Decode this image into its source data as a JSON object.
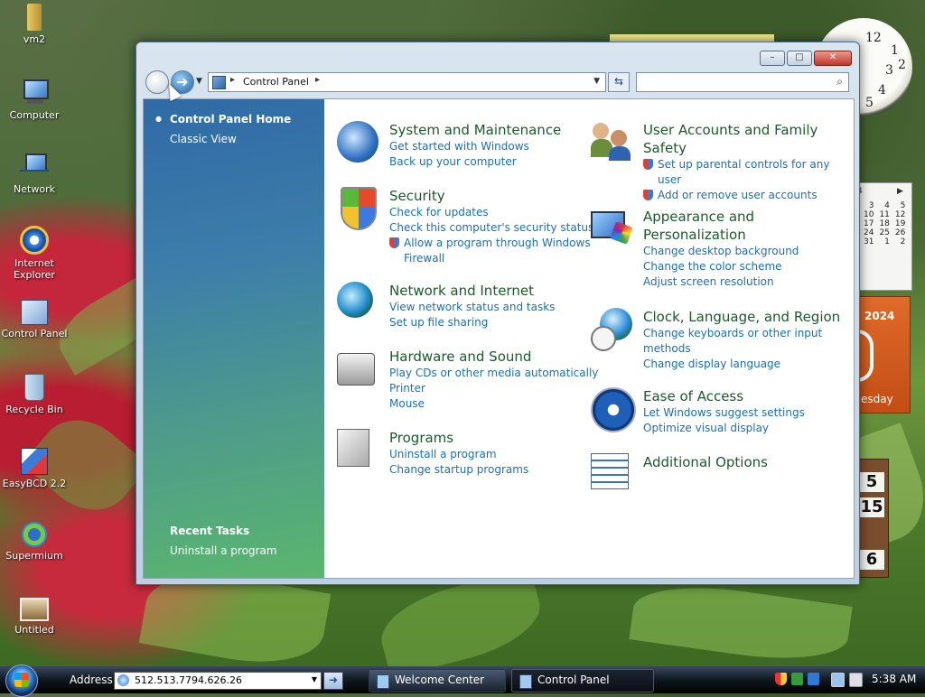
{
  "desktop": {
    "icons": [
      {
        "label": "vm2"
      },
      {
        "label": "Computer"
      },
      {
        "label": "Network"
      },
      {
        "label": "Internet Explorer"
      },
      {
        "label": "Control Panel"
      },
      {
        "label": "Recycle Bin"
      },
      {
        "label": "EasyBCD 2.2"
      },
      {
        "label": "Supermium"
      },
      {
        "label": "Untitled"
      }
    ]
  },
  "gadgets": {
    "clock_numbers": [
      "12",
      "1",
      "2",
      "3",
      "4",
      "5"
    ],
    "calendar_rows": [
      [
        "3",
        "4",
        "5"
      ],
      [
        "10",
        "11",
        "12"
      ],
      [
        "17",
        "18",
        "19"
      ],
      [
        "24",
        "25",
        "26"
      ],
      [
        "31",
        "1",
        "2"
      ]
    ],
    "calendar_header": "4",
    "calendar_year": "2024",
    "calendar_day_fragment": "esday",
    "counter_values": [
      "5",
      "15",
      "6"
    ]
  },
  "window": {
    "title_buttons": {
      "minimize": "–",
      "maximize": "□",
      "close": "✕"
    },
    "address": {
      "crumb": "Control Panel"
    },
    "search": {
      "placeholder": ""
    },
    "sidebar": {
      "home": "Control Panel Home",
      "classic": "Classic View",
      "recent_title": "Recent Tasks",
      "recent_item": "Uninstall a program"
    },
    "categories_left": [
      {
        "title": "System and Maintenance",
        "links": [
          "Get started with Windows",
          "Back up your computer"
        ],
        "icon": "system-maintenance-icon"
      },
      {
        "title": "Security",
        "links": [
          "Check for updates",
          "Check this computer's security status"
        ],
        "shield_links": [
          "Allow a program through Windows Firewall"
        ],
        "icon": "security-shield-icon"
      },
      {
        "title": "Network and Internet",
        "links": [
          "View network status and tasks",
          "Set up file sharing"
        ],
        "icon": "network-internet-icon"
      },
      {
        "title": "Hardware and Sound",
        "links": [
          "Play CDs or other media automatically",
          "Printer",
          "Mouse"
        ],
        "icon": "hardware-sound-icon"
      },
      {
        "title": "Programs",
        "links": [
          "Uninstall a program",
          "Change startup programs"
        ],
        "icon": "programs-icon"
      }
    ],
    "categories_right": [
      {
        "title": "User Accounts and Family Safety",
        "shield_links": [
          "Set up parental controls for any user",
          "Add or remove user accounts"
        ],
        "icon": "user-accounts-icon"
      },
      {
        "title": "Appearance and Personalization",
        "links": [
          "Change desktop background",
          "Change the color scheme",
          "Adjust screen resolution"
        ],
        "icon": "appearance-icon"
      },
      {
        "title": "Clock, Language, and Region",
        "links": [
          "Change keyboards or other input methods",
          "Change display language"
        ],
        "icon": "clock-language-icon"
      },
      {
        "title": "Ease of Access",
        "links": [
          "Let Windows suggest settings",
          "Optimize visual display"
        ],
        "icon": "ease-of-access-icon"
      },
      {
        "title": "Additional Options",
        "links": [],
        "icon": "additional-options-icon"
      }
    ]
  },
  "taskbar": {
    "address_label": "Address",
    "address_value": "512.513.7794.626.26",
    "go": "➜",
    "tasks": [
      {
        "label": "Welcome Center"
      },
      {
        "label": "Control Panel"
      }
    ],
    "time": "5:38 AM"
  }
}
